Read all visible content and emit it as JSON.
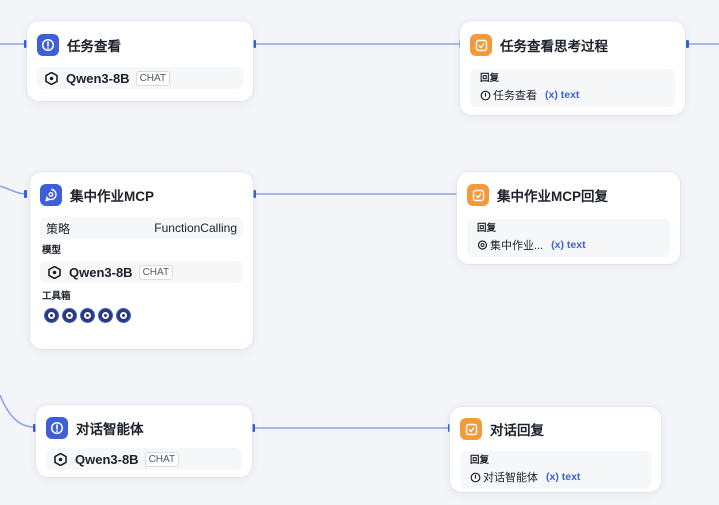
{
  "nodes": {
    "task_view": {
      "title": "任务查看",
      "model": "Qwen3-8B",
      "model_tag": "CHAT"
    },
    "task_view_reply": {
      "title": "任务查看思考过程",
      "reply_label": "回复",
      "ref_source": "任务查看",
      "ref_var": "(x) text"
    },
    "mcp": {
      "title": "集中作业MCP",
      "strategy_label": "策略",
      "strategy_value": "FunctionCalling",
      "model_label": "模型",
      "model": "Qwen3-8B",
      "model_tag": "CHAT",
      "tools_label": "工具箱",
      "tool_icons": [
        "tool-icon",
        "tool-icon",
        "tool-icon",
        "tool-icon",
        "tool-icon"
      ]
    },
    "mcp_reply": {
      "title": "集中作业MCP回复",
      "reply_label": "回复",
      "ref_source": "集中作业...",
      "ref_var": "(x) text"
    },
    "agent": {
      "title": "对话智能体",
      "model": "Qwen3-8B",
      "model_tag": "CHAT"
    },
    "agent_reply": {
      "title": "对话回复",
      "reply_label": "回复",
      "ref_source": "对话智能体",
      "ref_var": "(x) text"
    }
  },
  "colors": {
    "accent_blue": "#3d5fd8",
    "accent_orange": "#f59a3c",
    "edge": "#8fa3e8",
    "canvas": "#f4f5f8"
  }
}
